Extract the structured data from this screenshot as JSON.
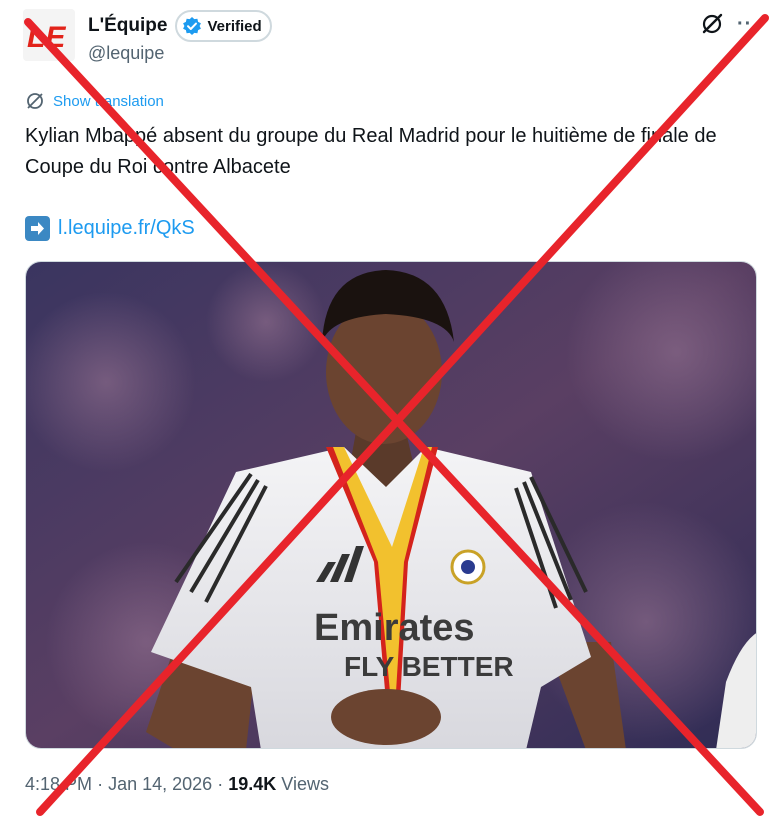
{
  "account": {
    "display_name": "L'Équipe",
    "badge_label": "Verified",
    "handle": "@lequipe",
    "logo_text": "LE"
  },
  "translation": {
    "label": "Show translation"
  },
  "tweet": {
    "text": "Kylian Mbappé absent du groupe du Real Madrid pour le huitième de finale de Coupe du Roi contre Albacete",
    "link_text": "l.lequipe.fr/QkS"
  },
  "media": {
    "description": "Photo of Kylian Mbappé in a white Real Madrid jersey with a red and yellow medal ribbon",
    "jersey_sponsor_line1": "Emirates",
    "jersey_sponsor_line2": "FLY BETTER"
  },
  "meta": {
    "time": "4:18 PM",
    "separator1": "·",
    "date": "Jan 14, 2026",
    "separator2": "·",
    "views_count": "19.4K",
    "views_label": "Views"
  },
  "overlay": {
    "color": "#e8242b"
  },
  "colors": {
    "link": "#1d9bf0",
    "secondary": "#536471",
    "verified": "#1d9bf0"
  }
}
